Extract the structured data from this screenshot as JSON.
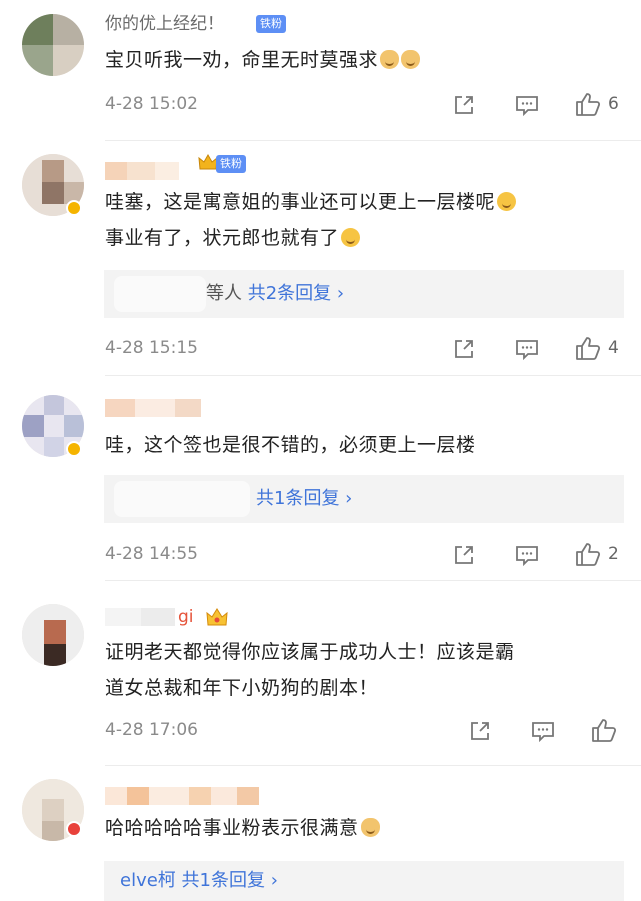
{
  "comments": [
    {
      "username": "你的优上经纪！",
      "badge": "铁粉",
      "text_lines": [
        "宝贝听我一劝，命里无时莫强求"
      ],
      "time": "4-28 15:02",
      "likes": "6"
    },
    {
      "badge": "铁粉",
      "text_lines": [
        "哇塞，这是寓意姐的事业还可以更上一层楼呢",
        "事业有了，状元郎也就有了"
      ],
      "reply_prefix": "等人",
      "reply_link": "共2条回复 ›",
      "time": "4-28 15:15",
      "likes": "4"
    },
    {
      "text_lines": [
        "哇，这个签也是很不错的，必须更上一层楼"
      ],
      "reply_link": "共1条回复 ›",
      "time": "4-28 14:55",
      "likes": "2"
    },
    {
      "username_suffix": "gi",
      "text_lines": [
        "证明老天都觉得你应该属于成功人士！应该是霸",
        "道女总裁和年下小奶狗的剧本！"
      ],
      "time": "4-28 17:06",
      "likes": ""
    },
    {
      "text_lines": [
        "哈哈哈哈哈事业粉表示很满意"
      ],
      "reply_user": "elve柯",
      "reply_link": "共1条回复 ›"
    }
  ],
  "icons": {
    "share": "share-icon",
    "comment": "comment-icon",
    "like": "like-icon"
  },
  "colors": {
    "link": "#3f74d9",
    "badge": "#5d8ff5",
    "meta": "#8a8a8a"
  }
}
